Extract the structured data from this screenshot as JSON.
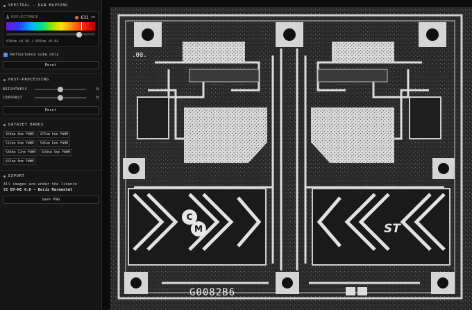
{
  "sidebar": {
    "spectral": {
      "title": "SPECTRAL - RGB MAPPING",
      "lambda": "λ",
      "reflectance_label": "REFLECTANCE",
      "wavelength_value": "631",
      "wavelength_unit": "nm",
      "spectrum_cursor_color": "#ff6a2a",
      "formula": "630nm ×0.96 + 655nm ×0.04",
      "checkbox_label": "Reflectance cube only",
      "checkbox_checked": true,
      "reset_label": "Reset"
    },
    "post": {
      "title": "POST-PROCESSING",
      "brightness_label": "BRIGHTNESS",
      "brightness_value": "0",
      "contrast_label": "CONTRAST",
      "contrast_value": "0",
      "reset_label": "Reset"
    },
    "dataset": {
      "title": "DATASET BANDS",
      "bands": [
        "458nm 8nm FWHM",
        "475nm 6nm FWHM",
        "516nm 6nm FWHM",
        "545nm 6nm FWHM",
        "580nm 12nm FWHM",
        "630nm 9nm FWHM",
        "655nm 8nm FWHM"
      ]
    },
    "export": {
      "title": "EXPORT",
      "licence_text": "All images are under the licence",
      "licence_name": "CC BY-NC 4.0 - Boris Marmontel",
      "save_label": "Save PNG"
    }
  },
  "viewer": {
    "die_id": "G0082B6",
    "corner_mark": ".00.",
    "logo_letters": [
      "C",
      "M"
    ],
    "brand_logo": "ST"
  }
}
